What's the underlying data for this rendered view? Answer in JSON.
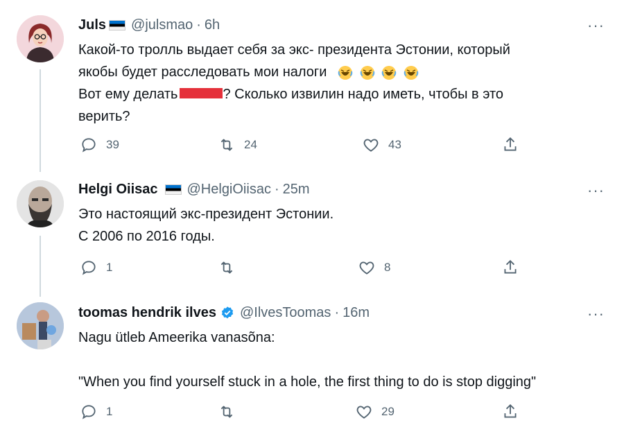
{
  "tweets": [
    {
      "name": "Juls",
      "handle": "@julsmao",
      "time": "6h",
      "lines": [
        "Какой-то тролль выдает себя за экс- президента Эстонии, который",
        "якобы будет расследовать мои налоги",
        "Вот ему делать",
        "? Сколько извилин надо иметь, чтобы в это",
        "верить?"
      ],
      "replies": "39",
      "retweets": "24",
      "likes": "43"
    },
    {
      "name": "Helgi Oiisac",
      "handle": "@HelgiOiisac",
      "time": "25m",
      "lines": [
        "Это настоящий экс-президент Эстонии.",
        "С 2006 по 2016 годы."
      ],
      "replies": "1",
      "retweets": "",
      "likes": "8"
    },
    {
      "name": "toomas hendrik ilves",
      "handle": "@IlvesToomas",
      "time": "16m",
      "lines": [
        "Nagu ütleb Ameerika vanasõna:",
        "\"When you find yourself stuck in a hole, the first thing to do is stop digging\""
      ],
      "replies": "1",
      "retweets": "",
      "likes": "29"
    }
  ],
  "ui": {
    "separator": "·",
    "more_label": "···"
  },
  "icons": [
    "reply-icon",
    "retweet-icon",
    "like-icon",
    "share-icon",
    "more-icon",
    "verified-badge-icon",
    "estonian-flag-icon",
    "laughing-emoji-icon"
  ],
  "colors": {
    "text": "#0f1419",
    "secondary": "#536471",
    "verified": "#1d9bf0",
    "thread_line": "#cfd9de",
    "redaction": "#e5303a"
  }
}
